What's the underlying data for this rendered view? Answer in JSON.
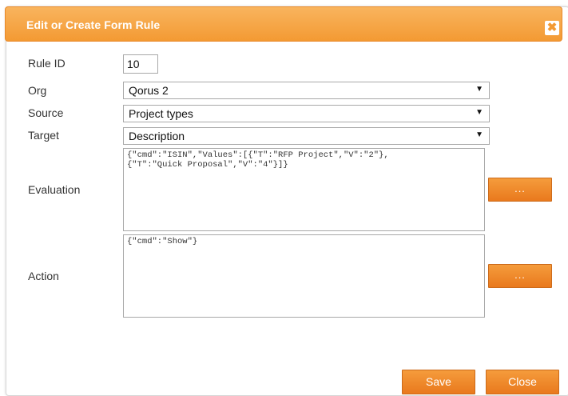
{
  "dialog": {
    "title": "Edit or Create Form Rule",
    "close_icon_glyph": "✖"
  },
  "form": {
    "rule_id": {
      "label": "Rule ID",
      "value": "10"
    },
    "org": {
      "label": "Org",
      "value": "Qorus 2"
    },
    "source": {
      "label": "Source",
      "value": "Project types"
    },
    "target": {
      "label": "Target",
      "value": "Description"
    },
    "evaluation": {
      "label": "Evaluation",
      "value": "{\"cmd\":\"ISIN\",\"Values\":[{\"T\":\"RFP Project\",\"V\":\"2\"},\n{\"T\":\"Quick Proposal\",\"V\":\"4\"}]}",
      "button_label": "..."
    },
    "action": {
      "label": "Action",
      "value": "{\"cmd\":\"Show\"}",
      "button_label": "..."
    }
  },
  "buttons": {
    "save": "Save",
    "close": "Close"
  },
  "icons": {
    "dropdown_arrow": "▼"
  },
  "colors": {
    "accent": "#f39a33",
    "button": "#e9791d"
  }
}
